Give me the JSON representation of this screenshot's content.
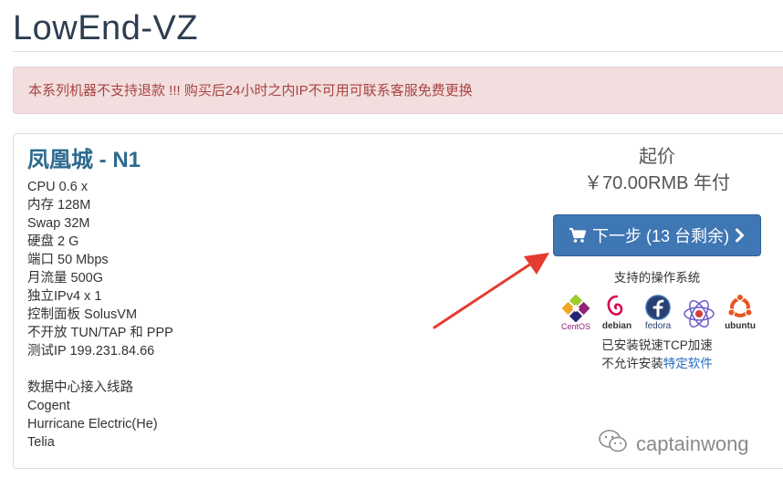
{
  "header": {
    "title": "LowEnd-VZ"
  },
  "alert": {
    "text": "本系列机器不支持退款 !!! 购买后24小时之内IP不可用可联系客服免费更换"
  },
  "product": {
    "name": "凤凰城 - N1",
    "specs": [
      "CPU 0.6 x",
      "内存 128M",
      "Swap 32M",
      "硬盘 2 G",
      "端口 50 Mbps",
      "月流量 500G",
      "独立IPv4 x 1",
      "控制面板 SolusVM",
      "不开放 TUN/TAP 和 PPP",
      "测试IP 199.231.84.66"
    ],
    "routes_title": "数据中心接入线路",
    "routes": [
      "Cogent",
      "Hurricane Electric(He)",
      "Telia"
    ],
    "price_label": "起价",
    "price_value": "￥70.00RMB 年付",
    "next_button": "下一步 (13 台剩余)",
    "os_title": "支持的操作系统",
    "os_logos": [
      {
        "name": "CentOS",
        "icon": "centos-icon"
      },
      {
        "name": "debian",
        "icon": "debian-icon"
      },
      {
        "name": "fedora",
        "icon": "fedora-icon"
      },
      {
        "name": "",
        "icon": "os-logo-icon"
      },
      {
        "name": "ubuntu",
        "icon": "ubuntu-icon"
      }
    ],
    "tcp_note": "已安装锐速TCP加速",
    "software_note_prefix": "不允许安装",
    "software_note_link": "特定软件"
  },
  "watermark": {
    "text": "captainwong"
  },
  "colors": {
    "title": "#2d3e50",
    "alert_bg": "#f2dede",
    "alert_text": "#a94442",
    "product_name": "#2c6a8e",
    "button_bg": "#3f76b4",
    "link": "#2a6cc0",
    "arrow": "#e53b30"
  }
}
